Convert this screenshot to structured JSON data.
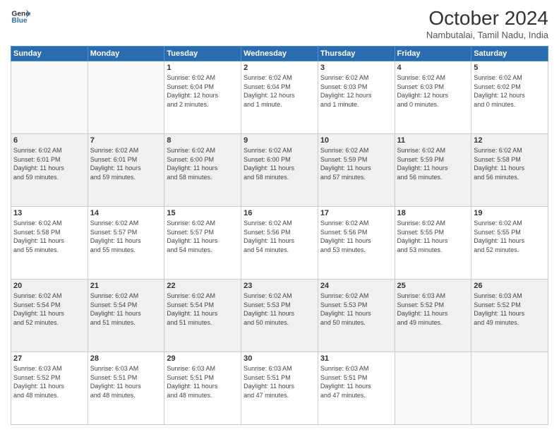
{
  "logo": {
    "line1": "General",
    "line2": "Blue"
  },
  "title": "October 2024",
  "subtitle": "Nambutalai, Tamil Nadu, India",
  "days_header": [
    "Sunday",
    "Monday",
    "Tuesday",
    "Wednesday",
    "Thursday",
    "Friday",
    "Saturday"
  ],
  "weeks": [
    {
      "shaded": false,
      "days": [
        {
          "num": "",
          "info": ""
        },
        {
          "num": "",
          "info": ""
        },
        {
          "num": "1",
          "info": "Sunrise: 6:02 AM\nSunset: 6:04 PM\nDaylight: 12 hours\nand 2 minutes."
        },
        {
          "num": "2",
          "info": "Sunrise: 6:02 AM\nSunset: 6:04 PM\nDaylight: 12 hours\nand 1 minute."
        },
        {
          "num": "3",
          "info": "Sunrise: 6:02 AM\nSunset: 6:03 PM\nDaylight: 12 hours\nand 1 minute."
        },
        {
          "num": "4",
          "info": "Sunrise: 6:02 AM\nSunset: 6:03 PM\nDaylight: 12 hours\nand 0 minutes."
        },
        {
          "num": "5",
          "info": "Sunrise: 6:02 AM\nSunset: 6:02 PM\nDaylight: 12 hours\nand 0 minutes."
        }
      ]
    },
    {
      "shaded": true,
      "days": [
        {
          "num": "6",
          "info": "Sunrise: 6:02 AM\nSunset: 6:01 PM\nDaylight: 11 hours\nand 59 minutes."
        },
        {
          "num": "7",
          "info": "Sunrise: 6:02 AM\nSunset: 6:01 PM\nDaylight: 11 hours\nand 59 minutes."
        },
        {
          "num": "8",
          "info": "Sunrise: 6:02 AM\nSunset: 6:00 PM\nDaylight: 11 hours\nand 58 minutes."
        },
        {
          "num": "9",
          "info": "Sunrise: 6:02 AM\nSunset: 6:00 PM\nDaylight: 11 hours\nand 58 minutes."
        },
        {
          "num": "10",
          "info": "Sunrise: 6:02 AM\nSunset: 5:59 PM\nDaylight: 11 hours\nand 57 minutes."
        },
        {
          "num": "11",
          "info": "Sunrise: 6:02 AM\nSunset: 5:59 PM\nDaylight: 11 hours\nand 56 minutes."
        },
        {
          "num": "12",
          "info": "Sunrise: 6:02 AM\nSunset: 5:58 PM\nDaylight: 11 hours\nand 56 minutes."
        }
      ]
    },
    {
      "shaded": false,
      "days": [
        {
          "num": "13",
          "info": "Sunrise: 6:02 AM\nSunset: 5:58 PM\nDaylight: 11 hours\nand 55 minutes."
        },
        {
          "num": "14",
          "info": "Sunrise: 6:02 AM\nSunset: 5:57 PM\nDaylight: 11 hours\nand 55 minutes."
        },
        {
          "num": "15",
          "info": "Sunrise: 6:02 AM\nSunset: 5:57 PM\nDaylight: 11 hours\nand 54 minutes."
        },
        {
          "num": "16",
          "info": "Sunrise: 6:02 AM\nSunset: 5:56 PM\nDaylight: 11 hours\nand 54 minutes."
        },
        {
          "num": "17",
          "info": "Sunrise: 6:02 AM\nSunset: 5:56 PM\nDaylight: 11 hours\nand 53 minutes."
        },
        {
          "num": "18",
          "info": "Sunrise: 6:02 AM\nSunset: 5:55 PM\nDaylight: 11 hours\nand 53 minutes."
        },
        {
          "num": "19",
          "info": "Sunrise: 6:02 AM\nSunset: 5:55 PM\nDaylight: 11 hours\nand 52 minutes."
        }
      ]
    },
    {
      "shaded": true,
      "days": [
        {
          "num": "20",
          "info": "Sunrise: 6:02 AM\nSunset: 5:54 PM\nDaylight: 11 hours\nand 52 minutes."
        },
        {
          "num": "21",
          "info": "Sunrise: 6:02 AM\nSunset: 5:54 PM\nDaylight: 11 hours\nand 51 minutes."
        },
        {
          "num": "22",
          "info": "Sunrise: 6:02 AM\nSunset: 5:54 PM\nDaylight: 11 hours\nand 51 minutes."
        },
        {
          "num": "23",
          "info": "Sunrise: 6:02 AM\nSunset: 5:53 PM\nDaylight: 11 hours\nand 50 minutes."
        },
        {
          "num": "24",
          "info": "Sunrise: 6:02 AM\nSunset: 5:53 PM\nDaylight: 11 hours\nand 50 minutes."
        },
        {
          "num": "25",
          "info": "Sunrise: 6:03 AM\nSunset: 5:52 PM\nDaylight: 11 hours\nand 49 minutes."
        },
        {
          "num": "26",
          "info": "Sunrise: 6:03 AM\nSunset: 5:52 PM\nDaylight: 11 hours\nand 49 minutes."
        }
      ]
    },
    {
      "shaded": false,
      "days": [
        {
          "num": "27",
          "info": "Sunrise: 6:03 AM\nSunset: 5:52 PM\nDaylight: 11 hours\nand 48 minutes."
        },
        {
          "num": "28",
          "info": "Sunrise: 6:03 AM\nSunset: 5:51 PM\nDaylight: 11 hours\nand 48 minutes."
        },
        {
          "num": "29",
          "info": "Sunrise: 6:03 AM\nSunset: 5:51 PM\nDaylight: 11 hours\nand 48 minutes."
        },
        {
          "num": "30",
          "info": "Sunrise: 6:03 AM\nSunset: 5:51 PM\nDaylight: 11 hours\nand 47 minutes."
        },
        {
          "num": "31",
          "info": "Sunrise: 6:03 AM\nSunset: 5:51 PM\nDaylight: 11 hours\nand 47 minutes."
        },
        {
          "num": "",
          "info": ""
        },
        {
          "num": "",
          "info": ""
        }
      ]
    }
  ]
}
